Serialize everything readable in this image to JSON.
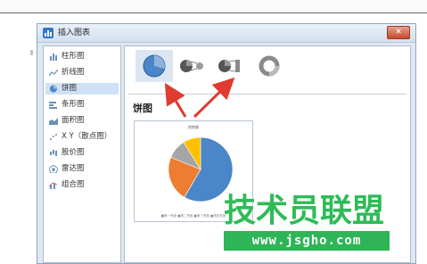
{
  "window": {
    "title": "插入图表",
    "close_glyph": "✕"
  },
  "sidebar": {
    "items": [
      {
        "label": "柱形图",
        "icon": "bar-chart-icon",
        "selected": false
      },
      {
        "label": "折线图",
        "icon": "line-chart-icon",
        "selected": false
      },
      {
        "label": "饼图",
        "icon": "pie-chart-icon",
        "selected": true
      },
      {
        "label": "条形图",
        "icon": "horizontal-bar-icon",
        "selected": false
      },
      {
        "label": "面积图",
        "icon": "area-chart-icon",
        "selected": false
      },
      {
        "label": "X Y（散点图）",
        "icon": "scatter-chart-icon",
        "selected": false
      },
      {
        "label": "股价图",
        "icon": "stock-chart-icon",
        "selected": false
      },
      {
        "label": "雷达图",
        "icon": "radar-chart-icon",
        "selected": false
      },
      {
        "label": "组合图",
        "icon": "combo-chart-icon",
        "selected": false
      }
    ]
  },
  "main": {
    "subtypes": [
      "pie-icon",
      "pie-of-pie-icon",
      "bar-of-pie-icon",
      "doughnut-icon"
    ],
    "section_title": "饼图",
    "preview_title": "销售额",
    "preview_legend": "■第一季度 ■第二季度 ■第三季度 ■第四季度"
  },
  "chart_data": {
    "type": "pie",
    "title": "销售额",
    "categories": [
      "第一季度",
      "第二季度",
      "第三季度",
      "第四季度"
    ],
    "values": [
      59,
      23,
      10,
      9
    ],
    "colors": [
      "#4a86c8",
      "#ed7d31",
      "#a5a5a5",
      "#ffc000"
    ]
  },
  "colors": {
    "accent": "#4a86c8",
    "arrow": "#e03b2f",
    "watermark": "#2fbb57"
  },
  "watermark": {
    "text": "技术员联盟",
    "url": "www.jsgho.com"
  }
}
